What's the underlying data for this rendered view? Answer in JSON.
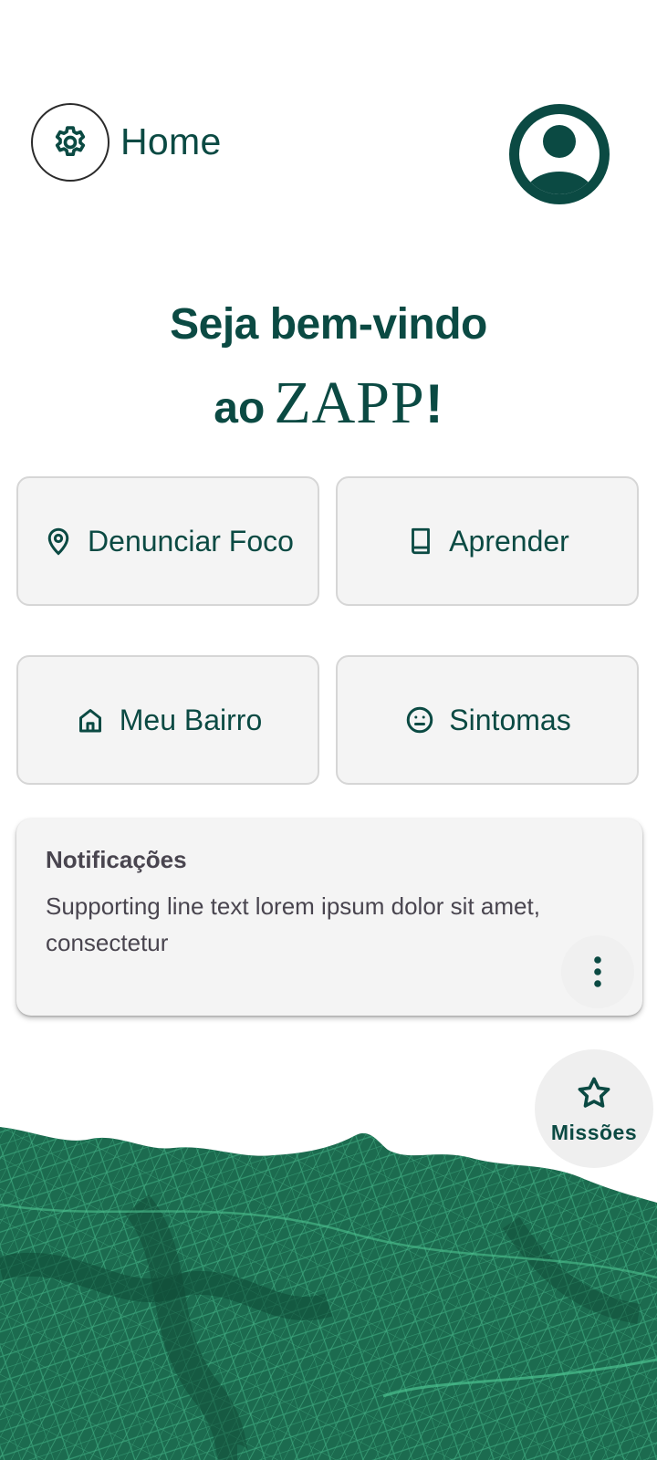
{
  "header": {
    "title": "Home",
    "settings_icon": "gear-icon",
    "profile_icon": "account-circle-icon"
  },
  "welcome": {
    "line1": "Seja bem-vindo",
    "line2_prefix": "ao",
    "brand": "ZAPP",
    "suffix": "!"
  },
  "actions": [
    {
      "label": "Denunciar Foco",
      "icon": "location-pin-icon"
    },
    {
      "label": "Aprender",
      "icon": "book-icon"
    },
    {
      "label": "Meu Bairro",
      "icon": "home-icon"
    },
    {
      "label": "Sintomas",
      "icon": "neutral-face-icon"
    }
  ],
  "notification": {
    "title": "Notificações",
    "body": "Supporting line text lorem ipsum dolor sit amet, consectetur",
    "menu_icon": "more-vertical-icon"
  },
  "missions": {
    "label": "Missões",
    "icon": "star-outline-icon"
  },
  "colors": {
    "primary": "#0b4a43",
    "tile_bg": "#f4f4f4",
    "map_green": "#1c6b4f"
  }
}
